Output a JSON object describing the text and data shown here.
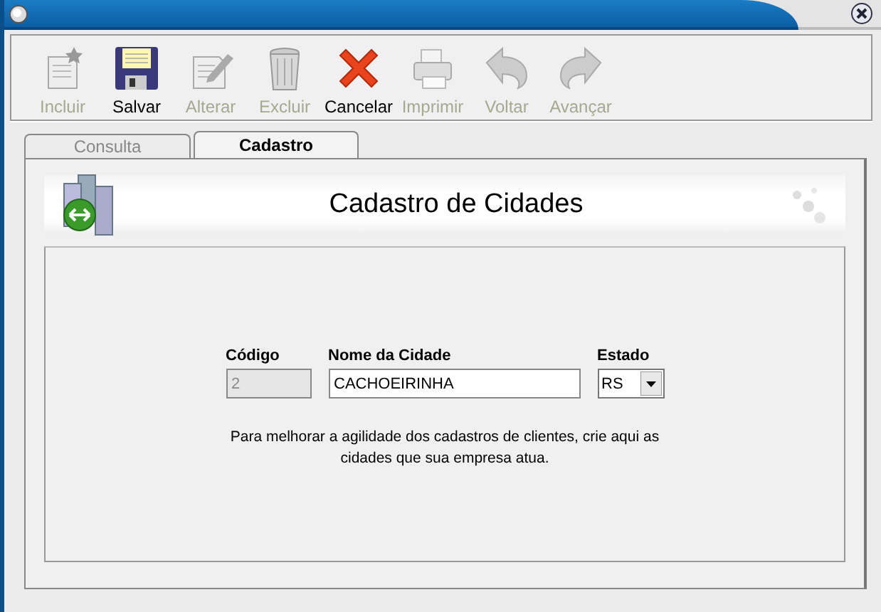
{
  "toolbar": [
    {
      "label": "Incluir",
      "disabled": true
    },
    {
      "label": "Salvar",
      "disabled": false
    },
    {
      "label": "Alterar",
      "disabled": true
    },
    {
      "label": "Excluir",
      "disabled": true
    },
    {
      "label": "Cancelar",
      "disabled": false
    },
    {
      "label": "Imprimir",
      "disabled": true
    },
    {
      "label": "Voltar",
      "disabled": true
    },
    {
      "label": "Avançar",
      "disabled": true
    }
  ],
  "tabs": [
    {
      "label": "Consulta",
      "selected": false
    },
    {
      "label": "Cadastro",
      "selected": true
    }
  ],
  "header": {
    "title": "Cadastro de Cidades"
  },
  "form": {
    "code": {
      "label": "Código",
      "value": "2",
      "disabled": true
    },
    "city": {
      "label": "Nome da Cidade",
      "value": "CACHOEIRINHA"
    },
    "state": {
      "label": "Estado",
      "value": "RS"
    },
    "hint": "Para melhorar a agilidade dos cadastros de clientes, crie aqui as cidades que sua empresa atua."
  }
}
